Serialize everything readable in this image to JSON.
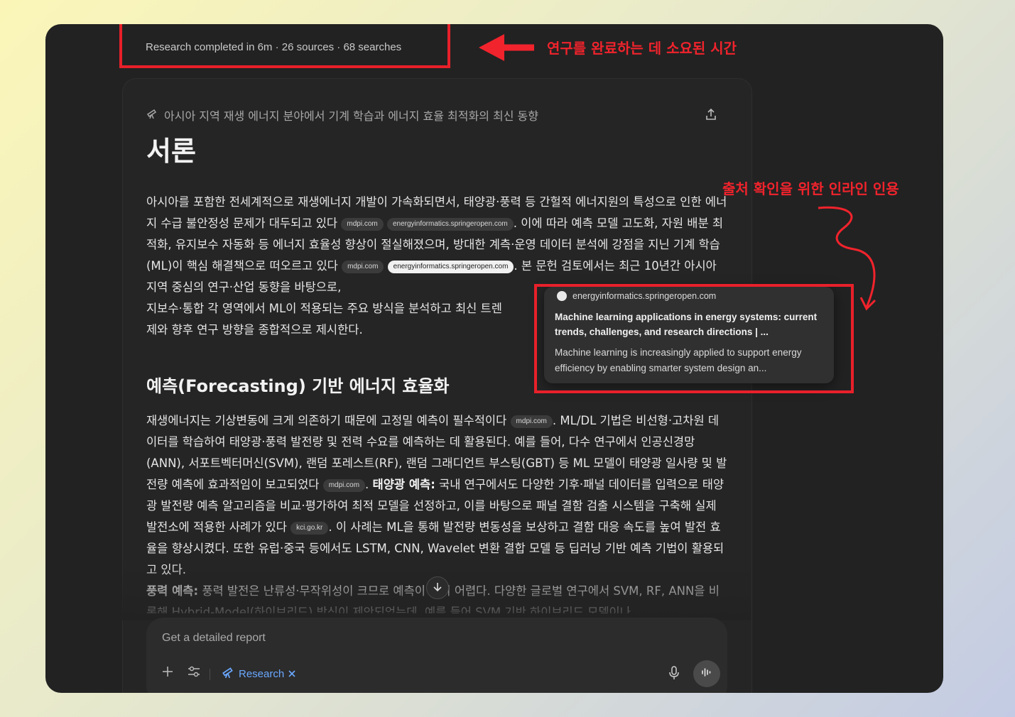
{
  "status": {
    "text": "Research completed in 6m · 26 sources · 68 searches"
  },
  "annotations": {
    "time_label": "연구를 완료하는 데 소요된 시간",
    "citation_label": "출처 확인을 위한 인라인 인용"
  },
  "document": {
    "subtitle": "아시아 지역 재생 에너지 분야에서 기계 학습과 에너지 효율 최적화의 최신 동향",
    "title": "서론",
    "intro": {
      "s1": "아시아를 포함한 전세계적으로 재생에너지 개발이 가속화되면서, 태양광·풍력 등 간헐적 에너지원의 특성으로 인한 에너지 수급 불안정성 문제가 대두되고 있다",
      "c1": "mdpi.com",
      "c2": "energyinformatics.springeropen.com",
      "s2": ". 이에 따라 예측 모델 고도화, 자원 배분 최적화, 유지보수 자동화 등 에너지 효율성 향상이 절실해졌으며, 방대한 계측·운영 데이터 분석에 강점을 지닌 기계 학습(ML)이 핵심 해결책으로 떠오르고 있다",
      "c3": "mdpi.com",
      "c4": "energyinformatics.springeropen.com",
      "s3": ". 본 문헌 검토에서는 최근 10년간 아시아 지역 중심의 연구·산업 동향을 바탕으로,",
      "s4": "지보수·통합 각 영역에서 ML이 적용되는 주요 방식을 분석하고 최신 트렌",
      "s5": "제와 향후 연구 방향을 종합적으로 제시한다."
    },
    "section2_title": "예측(Forecasting) 기반 에너지 효율화",
    "section2": {
      "s1": "재생에너지는 기상변동에 크게 의존하기 때문에 고정밀 예측이 필수적이다",
      "c1": "mdpi.com",
      "s2": ". ML/DL 기법은 비선형·고차원 데이터를 학습하여 태양광·풍력 발전량 및 전력 수요를 예측하는 데 활용된다. 예를 들어, 다수 연구에서 인공신경망(ANN), 서포트벡터머신(SVM), 랜덤 포레스트(RF), 랜덤 그래디언트 부스팅(GBT) 등 ML 모델이 태양광 일사량 및 발전량 예측에 효과적임이 보고되었다",
      "c2": "mdpi.com",
      "bold1": "태양광 예측:",
      "s3": " 국내 연구에서도 다양한 기후·패널 데이터를 입력으로 태양광 발전량 예측 알고리즘을 비교·평가하여 최적 모델을 선정하고, 이를 바탕으로 패널 결함 검출 시스템을 구축해 실제 발전소에 적용한 사례가 있다",
      "c3": "kci.go.kr",
      "s4": ". 이 사례는 ML을 통해 발전량 변동성을 보상하고 결함 대응 속도를 높여 발전 효율을 향상시켰다. 또한 유럽·중국 등에서도 LSTM, CNN, Wavelet 변환 결합 모델 등 딥러닝 기반 예측 기법이 활용되고 있다.",
      "bold2": "풍력 예측:",
      "s5": " 풍력 발전은 난류성·무작위성이 크므로 예측이 특히 어렵다. 다양한 글로벌 연구에서 SVM, RF, ANN을 비롯해 Hybrid-Model(하이브리드) 방식이 제안되었는데, 예를 들어 SVM 기반 하이브리드 모델이나"
    }
  },
  "popover": {
    "source": "energyinformatics.springeropen.com",
    "title": "Machine learning applications in energy systems: current trends, challenges, and research directions | ...",
    "description": "Machine learning is increasingly applied to support energy efficiency by enabling smarter system design an..."
  },
  "composer": {
    "placeholder": "Get a detailed report",
    "research_label": "Research"
  }
}
